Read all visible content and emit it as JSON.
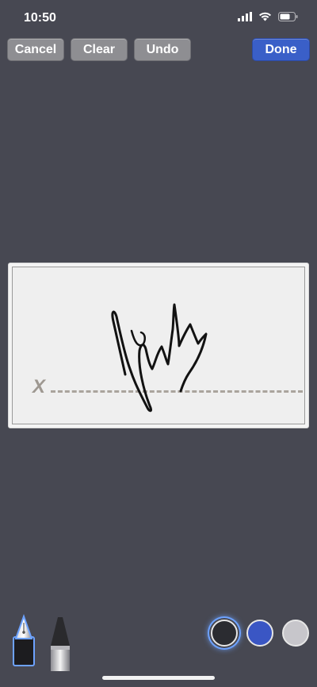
{
  "status_bar": {
    "time": "10:50"
  },
  "toolbar": {
    "cancel_label": "Cancel",
    "clear_label": "Clear",
    "undo_label": "Undo",
    "done_label": "Done"
  },
  "signature_pad": {
    "x_mark": "X"
  },
  "pen_tools": [
    {
      "icon": "fountain-pen-icon",
      "selected": true
    },
    {
      "icon": "marker-pen-icon",
      "selected": false
    }
  ],
  "color_palette": [
    {
      "name": "black",
      "color": "#2b2c31",
      "selected": true
    },
    {
      "name": "blue",
      "color": "#3a56c4",
      "selected": false
    },
    {
      "name": "gray",
      "color": "#c7c6cb",
      "selected": false
    }
  ],
  "colors": {
    "background": "#474852",
    "button": "#8e8e92",
    "accent": "#3a5fc8"
  }
}
